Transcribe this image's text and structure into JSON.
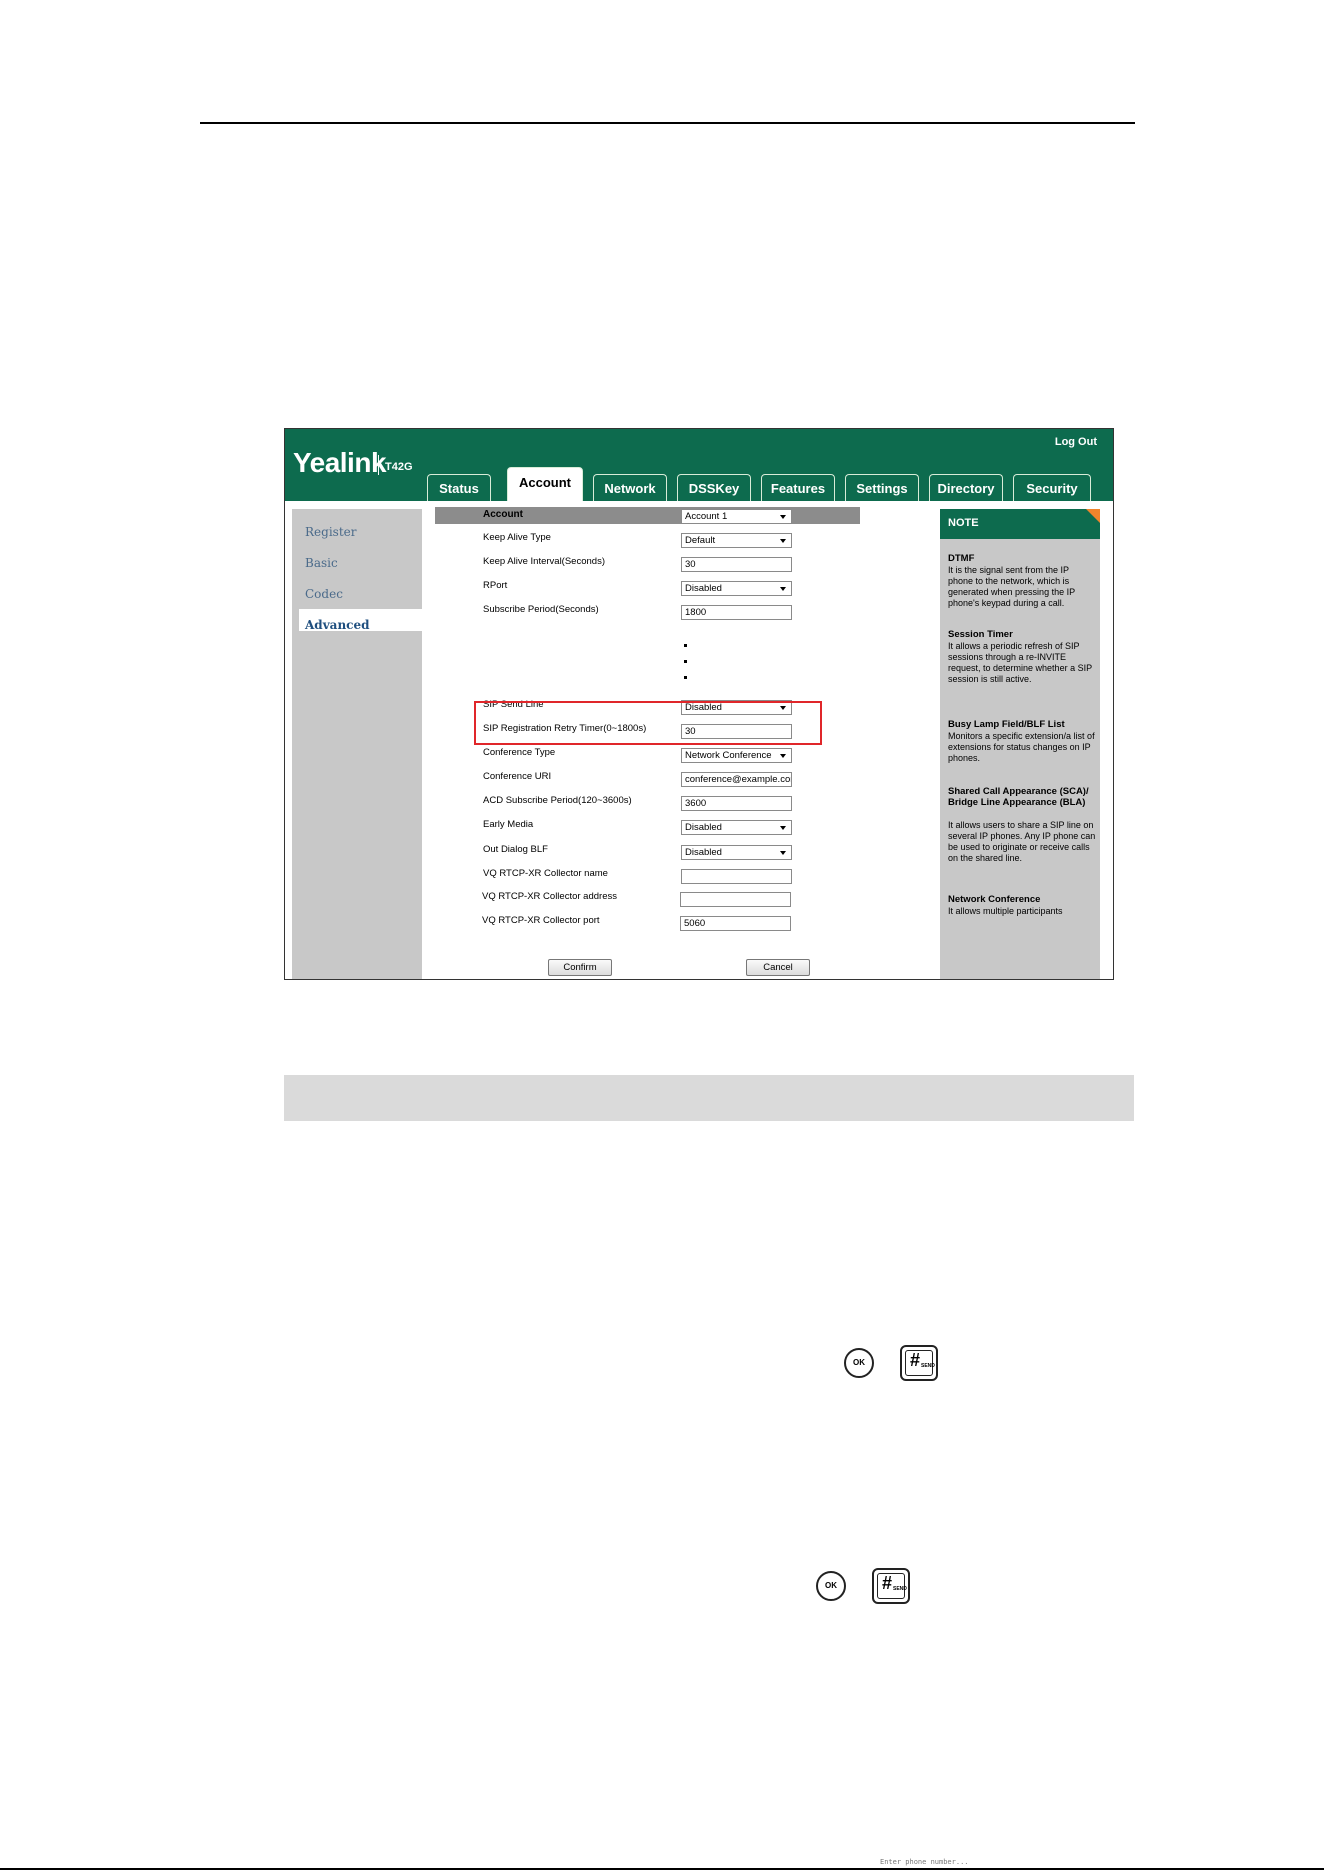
{
  "screenshot": {
    "brand": "Yealink",
    "model": "T42G",
    "logout": "Log Out",
    "tabs": [
      "Status",
      "Account",
      "Network",
      "DSSKey",
      "Features",
      "Settings",
      "Directory",
      "Security"
    ],
    "active_tab": "Account",
    "sidebar": [
      "Register",
      "Basic",
      "Codec",
      "Advanced"
    ],
    "active_sidebar": "Advanced",
    "account_label": "Account",
    "account_value": "Account 1",
    "rows_top": [
      {
        "label": "Keep Alive Type",
        "value": "Default",
        "select": true
      },
      {
        "label": "Keep Alive Interval(Seconds)",
        "value": "30",
        "select": false
      },
      {
        "label": "RPort",
        "value": "Disabled",
        "select": true
      },
      {
        "label": "Subscribe Period(Seconds)",
        "value": "1800",
        "select": false
      }
    ],
    "rows_bottom": [
      {
        "label": "SIP Send Line",
        "value": "Disabled",
        "select": true
      },
      {
        "label": "SIP Registration Retry Timer(0~1800s)",
        "value": "30",
        "select": false
      },
      {
        "label": "Conference Type",
        "value": "Network Conference",
        "select": true
      },
      {
        "label": "Conference URI",
        "value": "conference@example.com",
        "select": false
      },
      {
        "label": "ACD Subscribe Period(120~3600s)",
        "value": "3600",
        "select": false
      },
      {
        "label": "Early Media",
        "value": "Disabled",
        "select": true
      },
      {
        "label": "Out Dialog BLF",
        "value": "Disabled",
        "select": true
      },
      {
        "label": "VQ RTCP-XR Collector name",
        "value": "",
        "select": false
      },
      {
        "label": "VQ RTCP-XR Collector address",
        "value": "",
        "select": false
      },
      {
        "label": "VQ RTCP-XR Collector port",
        "value": "5060",
        "select": false
      }
    ],
    "confirm": "Confirm",
    "cancel": "Cancel",
    "note": {
      "title": "NOTE",
      "sections": [
        {
          "heading": "DTMF",
          "text": "It is the signal sent from the IP phone to the network, which is generated when pressing the IP phone's keypad during a call."
        },
        {
          "heading": "Session Timer",
          "text": "It allows a periodic refresh of SIP sessions through a re-INVITE request, to determine whether a SIP session is still active."
        },
        {
          "heading": "Busy Lamp Field/BLF List",
          "text": "Monitors a specific extension/a list of extensions for status changes on IP phones."
        },
        {
          "heading": "Shared Call Appearance (SCA)/ Bridge Line Appearance (BLA)",
          "text": "It allows users to share a SIP line on several IP phones. Any IP phone can be used to originate or receive calls on the shared line."
        },
        {
          "heading": "Network Conference",
          "text": "It allows multiple participants"
        }
      ]
    }
  },
  "keys": {
    "ok": "OK",
    "hash": "#",
    "send": "SEND"
  },
  "footer_scribble": "Enter phone number..."
}
